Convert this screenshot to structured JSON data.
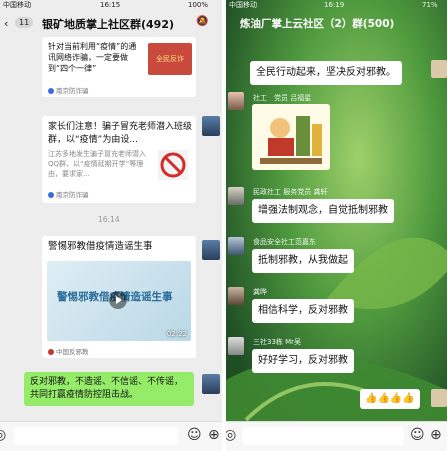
{
  "left": {
    "status": {
      "carrier": "中国移动",
      "time": "16:15",
      "battery": "100%"
    },
    "nav": {
      "unread": "11",
      "title": "银矿地质掌上社区群(492)",
      "mute_icon": "bell-off-icon"
    },
    "card1": {
      "title": "针对当前利用“疫情”的通讯网络诈骗，一定要做到“四个一律”",
      "source": "南京防诈骗",
      "thumb_text": "全民反诈"
    },
    "card2": {
      "title": "家长们注意！骗子冒充老师潜入班级群，以“疫情”为由设...",
      "desc": "江苏多地发生骗子冒充老师潜入QQ群，以“疫情延期开学”等理由，要求家...",
      "source": "南京防诈骗"
    },
    "timestamp": "16:14",
    "video": {
      "title": "警惕邪教借疫情造谣生事",
      "overlay": "警惕邪教借疫情造谣生事",
      "duration": "02:22",
      "source": "中国反邪教"
    },
    "message": "反对邪教，不造谣、不信谣、不传谣，共同打赢疫情防控阻击战。"
  },
  "right": {
    "status": {
      "carrier": "中国移动",
      "time": "16:19",
      "battery": "71%"
    },
    "nav": {
      "title": "炼油厂掌上云社区（2）群(500)"
    },
    "messages": [
      {
        "sender": "",
        "text": "全民行动起来，坚决反对邪教。"
      },
      {
        "sender": "社工　党员 吕福星",
        "text": ""
      },
      {
        "sender": "民政社工 服务党员 龚轩",
        "text": "增强法制观念，自觉抵制邪教"
      },
      {
        "sender": "食品安全社工范嘉东",
        "text": "抵制邪教，从我做起"
      },
      {
        "sender": "龚晔",
        "text": "相信科学，反对邪教"
      },
      {
        "sender": "三社33栋 Mr吴",
        "text": "好好学习，反对邪教"
      }
    ],
    "emoji_msg": "👍👍👍👍"
  }
}
